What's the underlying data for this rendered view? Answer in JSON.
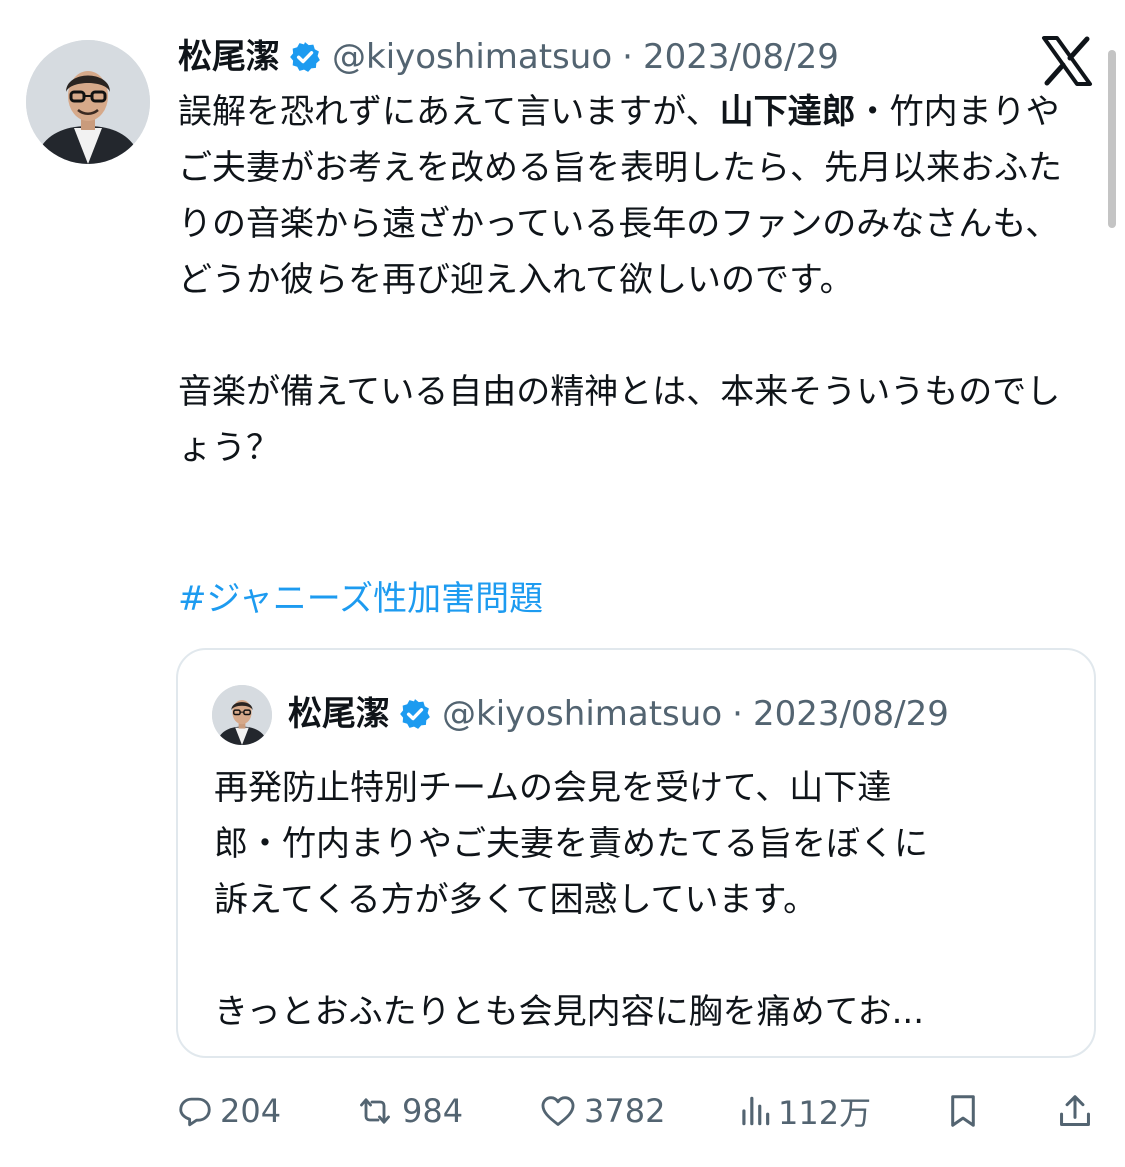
{
  "author": {
    "name": "松尾潔",
    "handle": "@kiyoshimatsuo",
    "separator": "·",
    "date": "2023/08/29"
  },
  "tweet": {
    "text_part1": "誤解を恐れずにあえて言いますが、",
    "text_bold": "山下達郎",
    "text_part2": "・竹内まりやご夫妻がお考えを改める旨を表明したら、先月以来おふたりの音楽から遠ざかっている長年のファンのみなさんも、どうか彼らを再び迎え入れて欲しいのです。\n\n音楽が備えている自由の精神とは、本来そういうものでしょう？",
    "hashtag": "#ジャニーズ性加害問題"
  },
  "quoted_tweet": {
    "name": "松尾潔",
    "handle": "@kiyoshimatsuo",
    "separator": "·",
    "date": "2023/08/29",
    "text": "再発防止特別チームの会見を受けて、山下達\n郎・竹内まりやご夫妻を責めたてる旨をぼくに\n訴えてくる方が多くて困惑しています。\n\nきっとおふたりとも会見内容に胸を痛めてお..."
  },
  "actions": {
    "replies": "204",
    "retweets": "984",
    "likes": "3782",
    "views": "112万"
  },
  "icons": {
    "verified": "verified-badge-icon",
    "brand": "x-logo-icon",
    "reply": "reply-icon",
    "retweet": "retweet-icon",
    "like": "heart-icon",
    "views": "views-icon",
    "bookmark": "bookmark-icon",
    "share": "share-icon"
  },
  "colors": {
    "text": "#0f1419",
    "muted": "#536471",
    "link": "#1d9bf0",
    "verified": "#1d9bf0",
    "border": "#e1e8ed"
  }
}
